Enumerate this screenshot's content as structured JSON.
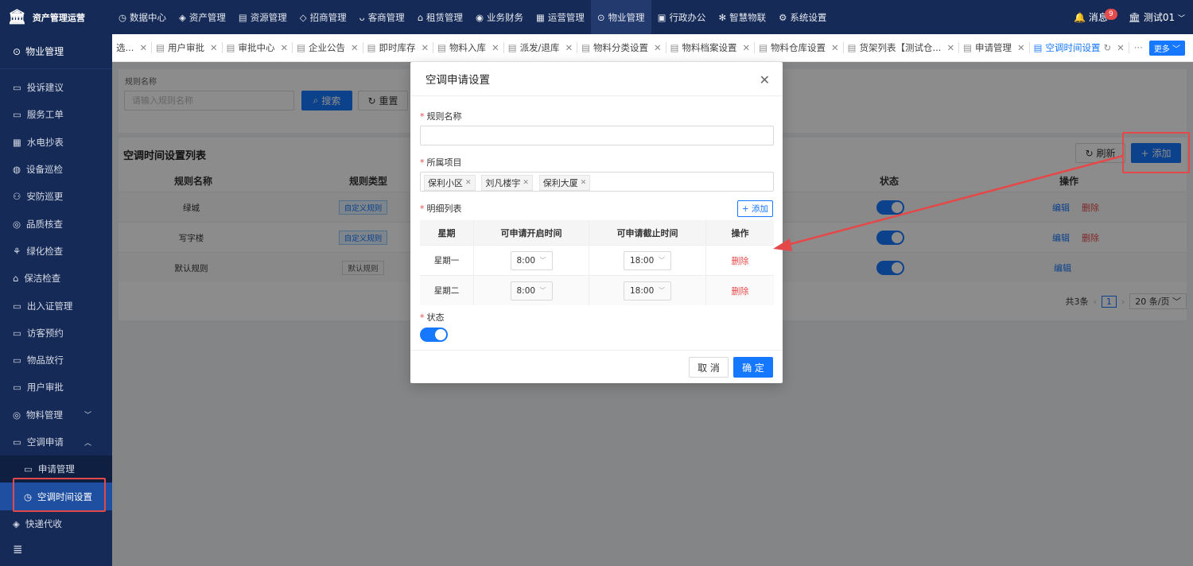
{
  "app": {
    "title": "资产管理运营"
  },
  "topnav": [
    {
      "icon": "dashboard-icon",
      "label": "数据中心"
    },
    {
      "icon": "cube-icon",
      "label": "资产管理"
    },
    {
      "icon": "building-icon",
      "label": "资源管理"
    },
    {
      "icon": "tag-icon",
      "label": "招商管理"
    },
    {
      "icon": "user-group-icon",
      "label": "客商管理"
    },
    {
      "icon": "house-icon",
      "label": "租赁管理"
    },
    {
      "icon": "finance-icon",
      "label": "业务财务"
    },
    {
      "icon": "chart-icon",
      "label": "运营管理"
    },
    {
      "icon": "property-icon",
      "label": "物业管理"
    },
    {
      "icon": "office-icon",
      "label": "行政办公"
    },
    {
      "icon": "iot-icon",
      "label": "智慧物联"
    },
    {
      "icon": "gear-icon",
      "label": "系统设置"
    }
  ],
  "header_right": {
    "messages_label": "消息",
    "message_count": "9",
    "user": "测试01"
  },
  "sidebar": {
    "header": "物业管理",
    "items": [
      {
        "label": "投诉建议"
      },
      {
        "label": "服务工单"
      },
      {
        "label": "水电抄表"
      },
      {
        "label": "设备巡检"
      },
      {
        "label": "安防巡更"
      },
      {
        "label": "品质核查"
      },
      {
        "label": "绿化检查"
      },
      {
        "label": "保洁检查"
      },
      {
        "label": "出入证管理"
      },
      {
        "label": "访客预约"
      },
      {
        "label": "物品放行"
      },
      {
        "label": "用户审批"
      },
      {
        "label": "物料管理"
      },
      {
        "label": "空调申请"
      },
      {
        "label": "申请管理"
      },
      {
        "label": "空调时间设置"
      },
      {
        "label": "快递代收"
      }
    ]
  },
  "tabs": [
    {
      "label": "选..."
    },
    {
      "label": "用户审批"
    },
    {
      "label": "审批中心"
    },
    {
      "label": "企业公告"
    },
    {
      "label": "即时库存"
    },
    {
      "label": "物料入库"
    },
    {
      "label": "派发/退库"
    },
    {
      "label": "物料分类设置"
    },
    {
      "label": "物料档案设置"
    },
    {
      "label": "物料仓库设置"
    },
    {
      "label": "货架列表【测试仓..."
    },
    {
      "label": "申请管理"
    },
    {
      "label": "空调时间设置"
    }
  ],
  "tabs_more": "更多",
  "search": {
    "label": "规则名称",
    "placeholder": "请输入规则名称",
    "search_btn": "搜索",
    "reset_btn": "重置"
  },
  "list": {
    "title": "空调时间设置列表",
    "refresh_btn": "刷新",
    "add_btn": "添加",
    "columns": [
      "规则名称",
      "规则类型",
      "状态",
      "操作"
    ],
    "rows": [
      {
        "name": "绿城",
        "type": "自定义规则",
        "edit": "编辑",
        "delete": "删除"
      },
      {
        "name": "写字楼",
        "type": "自定义规则",
        "edit": "编辑",
        "delete": "删除"
      },
      {
        "name": "默认规则",
        "type": "默认规则",
        "edit": "编辑"
      }
    ],
    "pager": {
      "total": "共3条",
      "page": "1",
      "size": "20 条/页"
    }
  },
  "modal": {
    "title": "空调申请设置",
    "rule_name_label": "规则名称",
    "project_label": "所属项目",
    "projects": [
      "保利小区",
      "刘凡楼宇",
      "保利大厦"
    ],
    "detail_label": "明细列表",
    "detail_add": "+ 添加",
    "detail_columns": [
      "星期",
      "可申请开启时间",
      "可申请截止时间",
      "操作"
    ],
    "detail_rows": [
      {
        "day": "星期一",
        "start": "8:00",
        "end": "18:00",
        "action": "删除"
      },
      {
        "day": "星期二",
        "start": "8:00",
        "end": "18:00",
        "action": "删除"
      }
    ],
    "status_label": "状态",
    "cancel_btn": "取 消",
    "ok_btn": "确 定"
  }
}
